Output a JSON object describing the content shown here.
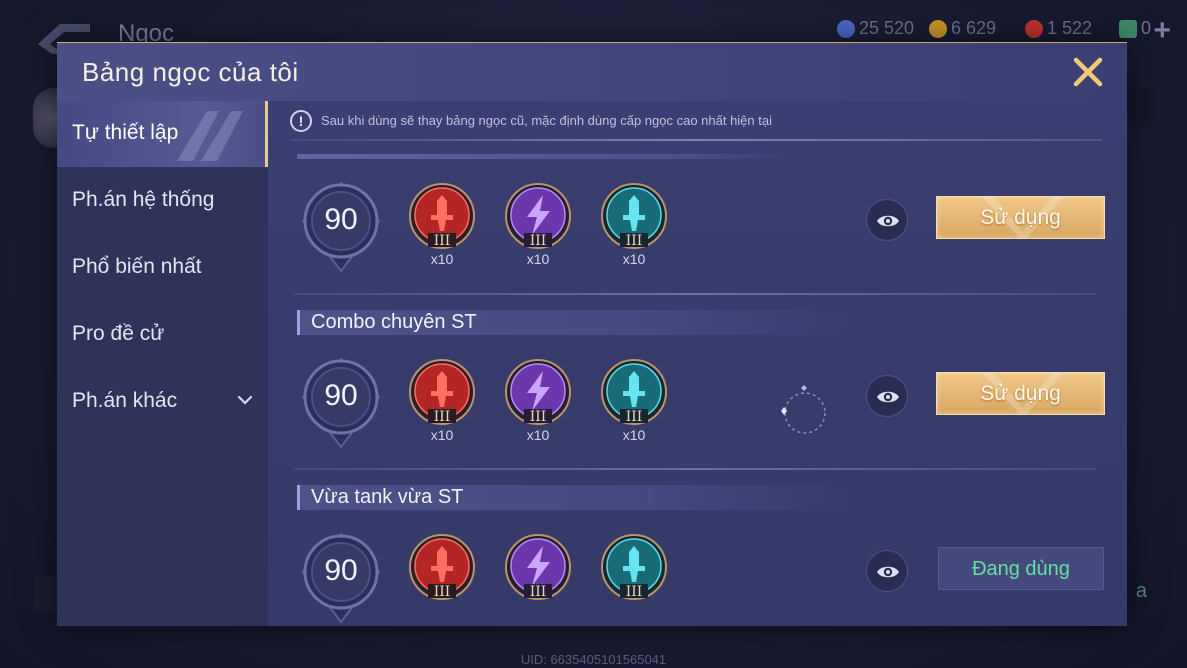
{
  "background": {
    "title": "Ngọc",
    "currencies": [
      {
        "icon": "blue-gem-icon",
        "value": "25 520",
        "color": "#4a68c8"
      },
      {
        "icon": "gold-coin-icon",
        "value": "6 629",
        "color": "#c8962a"
      },
      {
        "icon": "red-voucher-icon",
        "value": "1 522",
        "color": "#c0322e"
      },
      {
        "icon": "green-card-icon",
        "value": "0",
        "color": "#3e8a6a"
      }
    ],
    "uid": "UID: 6635405101565041",
    "right_text": "a"
  },
  "modal": {
    "title": "Bảng ngọc của tôi"
  },
  "sidebar": {
    "items": [
      {
        "label": "Tự thiết lập",
        "active": true
      },
      {
        "label": "Ph.án hệ thống",
        "active": false
      },
      {
        "label": "Phổ biến nhất",
        "active": false
      },
      {
        "label": "Pro đề cử",
        "active": false
      },
      {
        "label": "Ph.án khác",
        "active": false,
        "expandable": true
      }
    ]
  },
  "notice": {
    "icon": "!",
    "text": "Sau khi dùng sẽ thay bảng ngọc cũ, mặc định dùng cấp ngọc cao nhất hiện tại"
  },
  "gem_tier_label": "III",
  "rows": [
    {
      "section": "",
      "level": "90",
      "gems": [
        {
          "icon": "red-sword-gem-icon",
          "qty": "x10"
        },
        {
          "icon": "purple-lightning-gem-icon",
          "qty": "x10"
        },
        {
          "icon": "teal-sword-gem-icon",
          "qty": "x10"
        }
      ],
      "action": "Sử dụng",
      "in_use": false
    },
    {
      "section": "Combo chuyên ST",
      "level": "90",
      "gems": [
        {
          "icon": "red-sword-gem-icon",
          "qty": "x10"
        },
        {
          "icon": "purple-lightning-gem-icon",
          "qty": "x10"
        },
        {
          "icon": "teal-sword-gem-icon",
          "qty": "x10"
        }
      ],
      "action": "Sử dụng",
      "in_use": false
    },
    {
      "section": "Vừa tank vừa ST",
      "level": "90",
      "gems": [
        {
          "icon": "red-sword-gem-icon",
          "qty": ""
        },
        {
          "icon": "purple-lightning-gem-icon",
          "qty": ""
        },
        {
          "icon": "teal-sword-gem-icon",
          "qty": ""
        }
      ],
      "action": "Đang dùng",
      "in_use": true
    }
  ],
  "colors": {
    "accent_gold": "#e8c98a",
    "in_use_green": "#66dfa3",
    "close_gold": "#f2c977"
  }
}
